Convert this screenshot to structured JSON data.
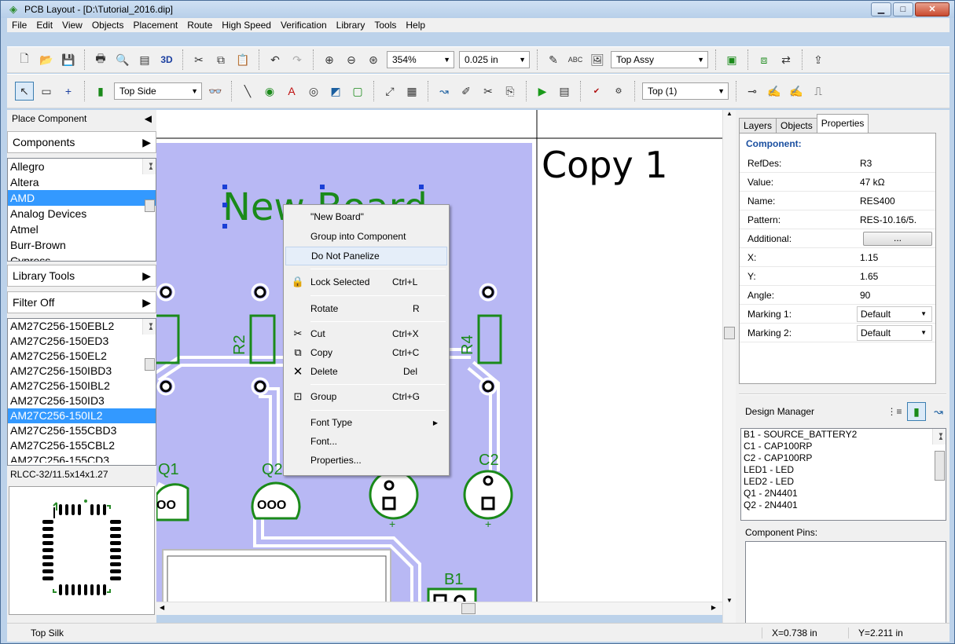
{
  "window": {
    "title": "PCB Layout - [D:\\Tutorial_2016.dip]",
    "app_icon": "pcb-app-icon"
  },
  "menu": [
    "File",
    "Edit",
    "View",
    "Objects",
    "Placement",
    "Route",
    "High Speed",
    "Verification",
    "Library",
    "Tools",
    "Help"
  ],
  "toolbar1": {
    "btn_3d": "3D",
    "zoom": "354%",
    "grid": "0.025 in",
    "abc_label": "ABC",
    "assy": "Top Assy"
  },
  "toolbar2": {
    "side": "Top Side",
    "layer": "Top (1)"
  },
  "left_panel": {
    "place_component": "Place Component",
    "components": "Components",
    "manufacturers": [
      "Allegro",
      "Altera",
      "AMD",
      "Analog Devices",
      "Atmel",
      "Burr-Brown",
      "Cypress"
    ],
    "selected_manufacturer": "AMD",
    "library_tools": "Library Tools",
    "filter": "Filter Off",
    "parts": [
      "AM27C256-150EBL2",
      "AM27C256-150ED3",
      "AM27C256-150EL2",
      "AM27C256-150IBD3",
      "AM27C256-150IBL2",
      "AM27C256-150ID3",
      "AM27C256-150IL2",
      "AM27C256-155CBD3",
      "AM27C256-155CBL2",
      "AM27C256-155CD3"
    ],
    "selected_part": "AM27C256-150IL2",
    "pattern_name": "RLCC-32/11.5x14x1.27"
  },
  "canvas": {
    "board_text": "New Board",
    "copy_text": "Copy 1",
    "refdes": [
      "R2",
      "R4",
      "Q1",
      "Q2",
      "C2",
      "B1"
    ]
  },
  "context_menu": {
    "items": [
      {
        "label": "\"New Board\"",
        "shortcut": "",
        "icon": ""
      },
      {
        "label": "Group into Component",
        "shortcut": "",
        "icon": ""
      },
      {
        "label": "Do Not Panelize",
        "shortcut": "",
        "icon": ""
      },
      {
        "label": "Lock Selected",
        "shortcut": "Ctrl+L",
        "icon": "lock-icon"
      },
      {
        "label": "Rotate",
        "shortcut": "R",
        "icon": ""
      },
      {
        "label": "Cut",
        "shortcut": "Ctrl+X",
        "icon": "scissors-icon"
      },
      {
        "label": "Copy",
        "shortcut": "Ctrl+C",
        "icon": "copy-icon"
      },
      {
        "label": "Delete",
        "shortcut": "Del",
        "icon": "delete-x-icon"
      },
      {
        "label": "Group",
        "shortcut": "Ctrl+G",
        "icon": "group-icon"
      },
      {
        "label": "Font Type",
        "shortcut": "",
        "icon": ""
      },
      {
        "label": "Font...",
        "shortcut": "",
        "icon": ""
      },
      {
        "label": "Properties...",
        "shortcut": "",
        "icon": ""
      }
    ]
  },
  "right_panel": {
    "tabs": [
      "Layers",
      "Objects",
      "Properties"
    ],
    "active_tab": "Properties",
    "section": "Component:",
    "props": [
      {
        "key": "RefDes:",
        "value": "R3"
      },
      {
        "key": "Value:",
        "value": "47 kΩ"
      },
      {
        "key": "Name:",
        "value": "RES400"
      },
      {
        "key": "Pattern:",
        "value": "RES-10.16/5."
      },
      {
        "key": "Additional:",
        "value": "..."
      },
      {
        "key": "X:",
        "value": "1.15"
      },
      {
        "key": "Y:",
        "value": "1.65"
      },
      {
        "key": "Angle:",
        "value": "90"
      },
      {
        "key": "Marking 1:",
        "value": "Default"
      },
      {
        "key": "Marking 2:",
        "value": "Default"
      }
    ],
    "design_manager": "Design Manager",
    "dm_items": [
      "B1 - SOURCE_BATTERY2",
      "C1 - CAP100RP",
      "C2 - CAP100RP",
      "LED1 - LED",
      "LED2 - LED",
      "Q1 - 2N4401",
      "Q2 - 2N4401"
    ],
    "component_pins": "Component Pins:"
  },
  "status": {
    "layer": "Top Silk",
    "x": "X=0.738 in",
    "y": "Y=2.211 in"
  },
  "colors": {
    "board": "#b8b8f4",
    "copper": "#008000",
    "selection": "#1a3fd6",
    "highlight": "#3399ff"
  }
}
